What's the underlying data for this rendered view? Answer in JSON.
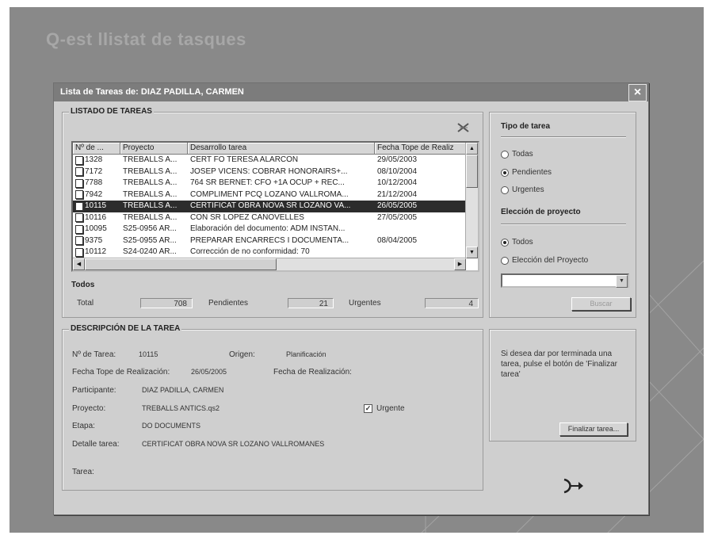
{
  "background_title": "Q-est llistat de tasques",
  "dialog": {
    "title": "Lista de Tareas de: DIAZ PADILLA, CARMEN",
    "close_label": "×"
  },
  "list_group": {
    "title": "LISTADO DE TAREAS",
    "columns": [
      "Nº de ...",
      "Proyecto",
      "Desarrollo tarea",
      "Fecha Tope de Realiz"
    ],
    "rows": [
      {
        "id": "1328",
        "project": "TREBALLS A...",
        "task": "CERT FO TERESA ALARCON",
        "date": "29/05/2003",
        "selected": false
      },
      {
        "id": "7172",
        "project": "TREBALLS A...",
        "task": "JOSEP VICENS: COBRAR HONORAIRS+...",
        "date": "08/10/2004",
        "selected": false
      },
      {
        "id": "7788",
        "project": "TREBALLS A...",
        "task": "764 SR BERNET: CFO +1A OCUP + REC...",
        "date": "10/12/2004",
        "selected": false
      },
      {
        "id": "7942",
        "project": "TREBALLS A...",
        "task": "COMPLIMENT PCQ LOZANO VALLROMA...",
        "date": "21/12/2004",
        "selected": false
      },
      {
        "id": "10115",
        "project": "TREBALLS A...",
        "task": "CERTIFICAT OBRA NOVA SR LOZANO VA...",
        "date": "26/05/2005",
        "selected": true
      },
      {
        "id": "10116",
        "project": "TREBALLS A...",
        "task": "CON SR LOPEZ CANOVELLES",
        "date": "27/05/2005",
        "selected": false
      },
      {
        "id": "10095",
        "project": "S25-0956 AR...",
        "task": "Elaboración del documento: ADM INSTAN...",
        "date": "",
        "selected": false
      },
      {
        "id": "9375",
        "project": "S25-0955 AR...",
        "task": "PREPARAR ENCARRECS I DOCUMENTA...",
        "date": "08/04/2005",
        "selected": false
      },
      {
        "id": "10112",
        "project": "S24-0240 AR...",
        "task": "Corrección de no conformidad: 70",
        "date": "",
        "selected": false
      }
    ],
    "totals": {
      "heading": "Todos",
      "total_label": "Total",
      "total_value": "708",
      "pending_label": "Pendientes",
      "pending_value": "21",
      "urgent_label": "Urgentes",
      "urgent_value": "4"
    }
  },
  "type_group": {
    "title": "Tipo de tarea",
    "options": [
      {
        "label": "Todas",
        "checked": false
      },
      {
        "label": "Pendientes",
        "checked": true
      },
      {
        "label": "Urgentes",
        "checked": false
      }
    ],
    "project_title": "Elección de proyecto",
    "project_options": [
      {
        "label": "Todos",
        "checked": true
      },
      {
        "label": "Elección del Proyecto",
        "checked": false
      }
    ],
    "project_combo_value": "",
    "search_button": "Buscar"
  },
  "description_group": {
    "title": "DESCRIPCIÓN DE LA TAREA",
    "task_no_label": "Nº de Tarea:",
    "task_no_value": "10115",
    "origin_label": "Origen:",
    "origin_value": "Planificación",
    "due_label": "Fecha Tope de Realización:",
    "due_value": "26/05/2005",
    "done_label": "Fecha de Realización:",
    "done_value": "",
    "participant_label": "Participante:",
    "participant_value": "DIAZ PADILLA, CARMEN",
    "project_label": "Proyecto:",
    "project_value": "TREBALLS ANTICS.qs2",
    "urgent_label": "Urgente",
    "urgent_checked": true,
    "stage_label": "Etapa:",
    "stage_value": "DO DOCUMENTS",
    "detail_label": "Detalle tarea:",
    "detail_value": "CERTIFICAT OBRA NOVA SR LOZANO VALLROMANES",
    "task_label": "Tarea:"
  },
  "finish_group": {
    "info": "Si desea dar por terminada una tarea, pulse el botón de 'Finalizar tarea'",
    "button": "Finalizar tarea..."
  },
  "icons": {
    "clear": "clear-filter-icon",
    "exit": "exit-arrow-icon",
    "doc": "document-icon"
  }
}
